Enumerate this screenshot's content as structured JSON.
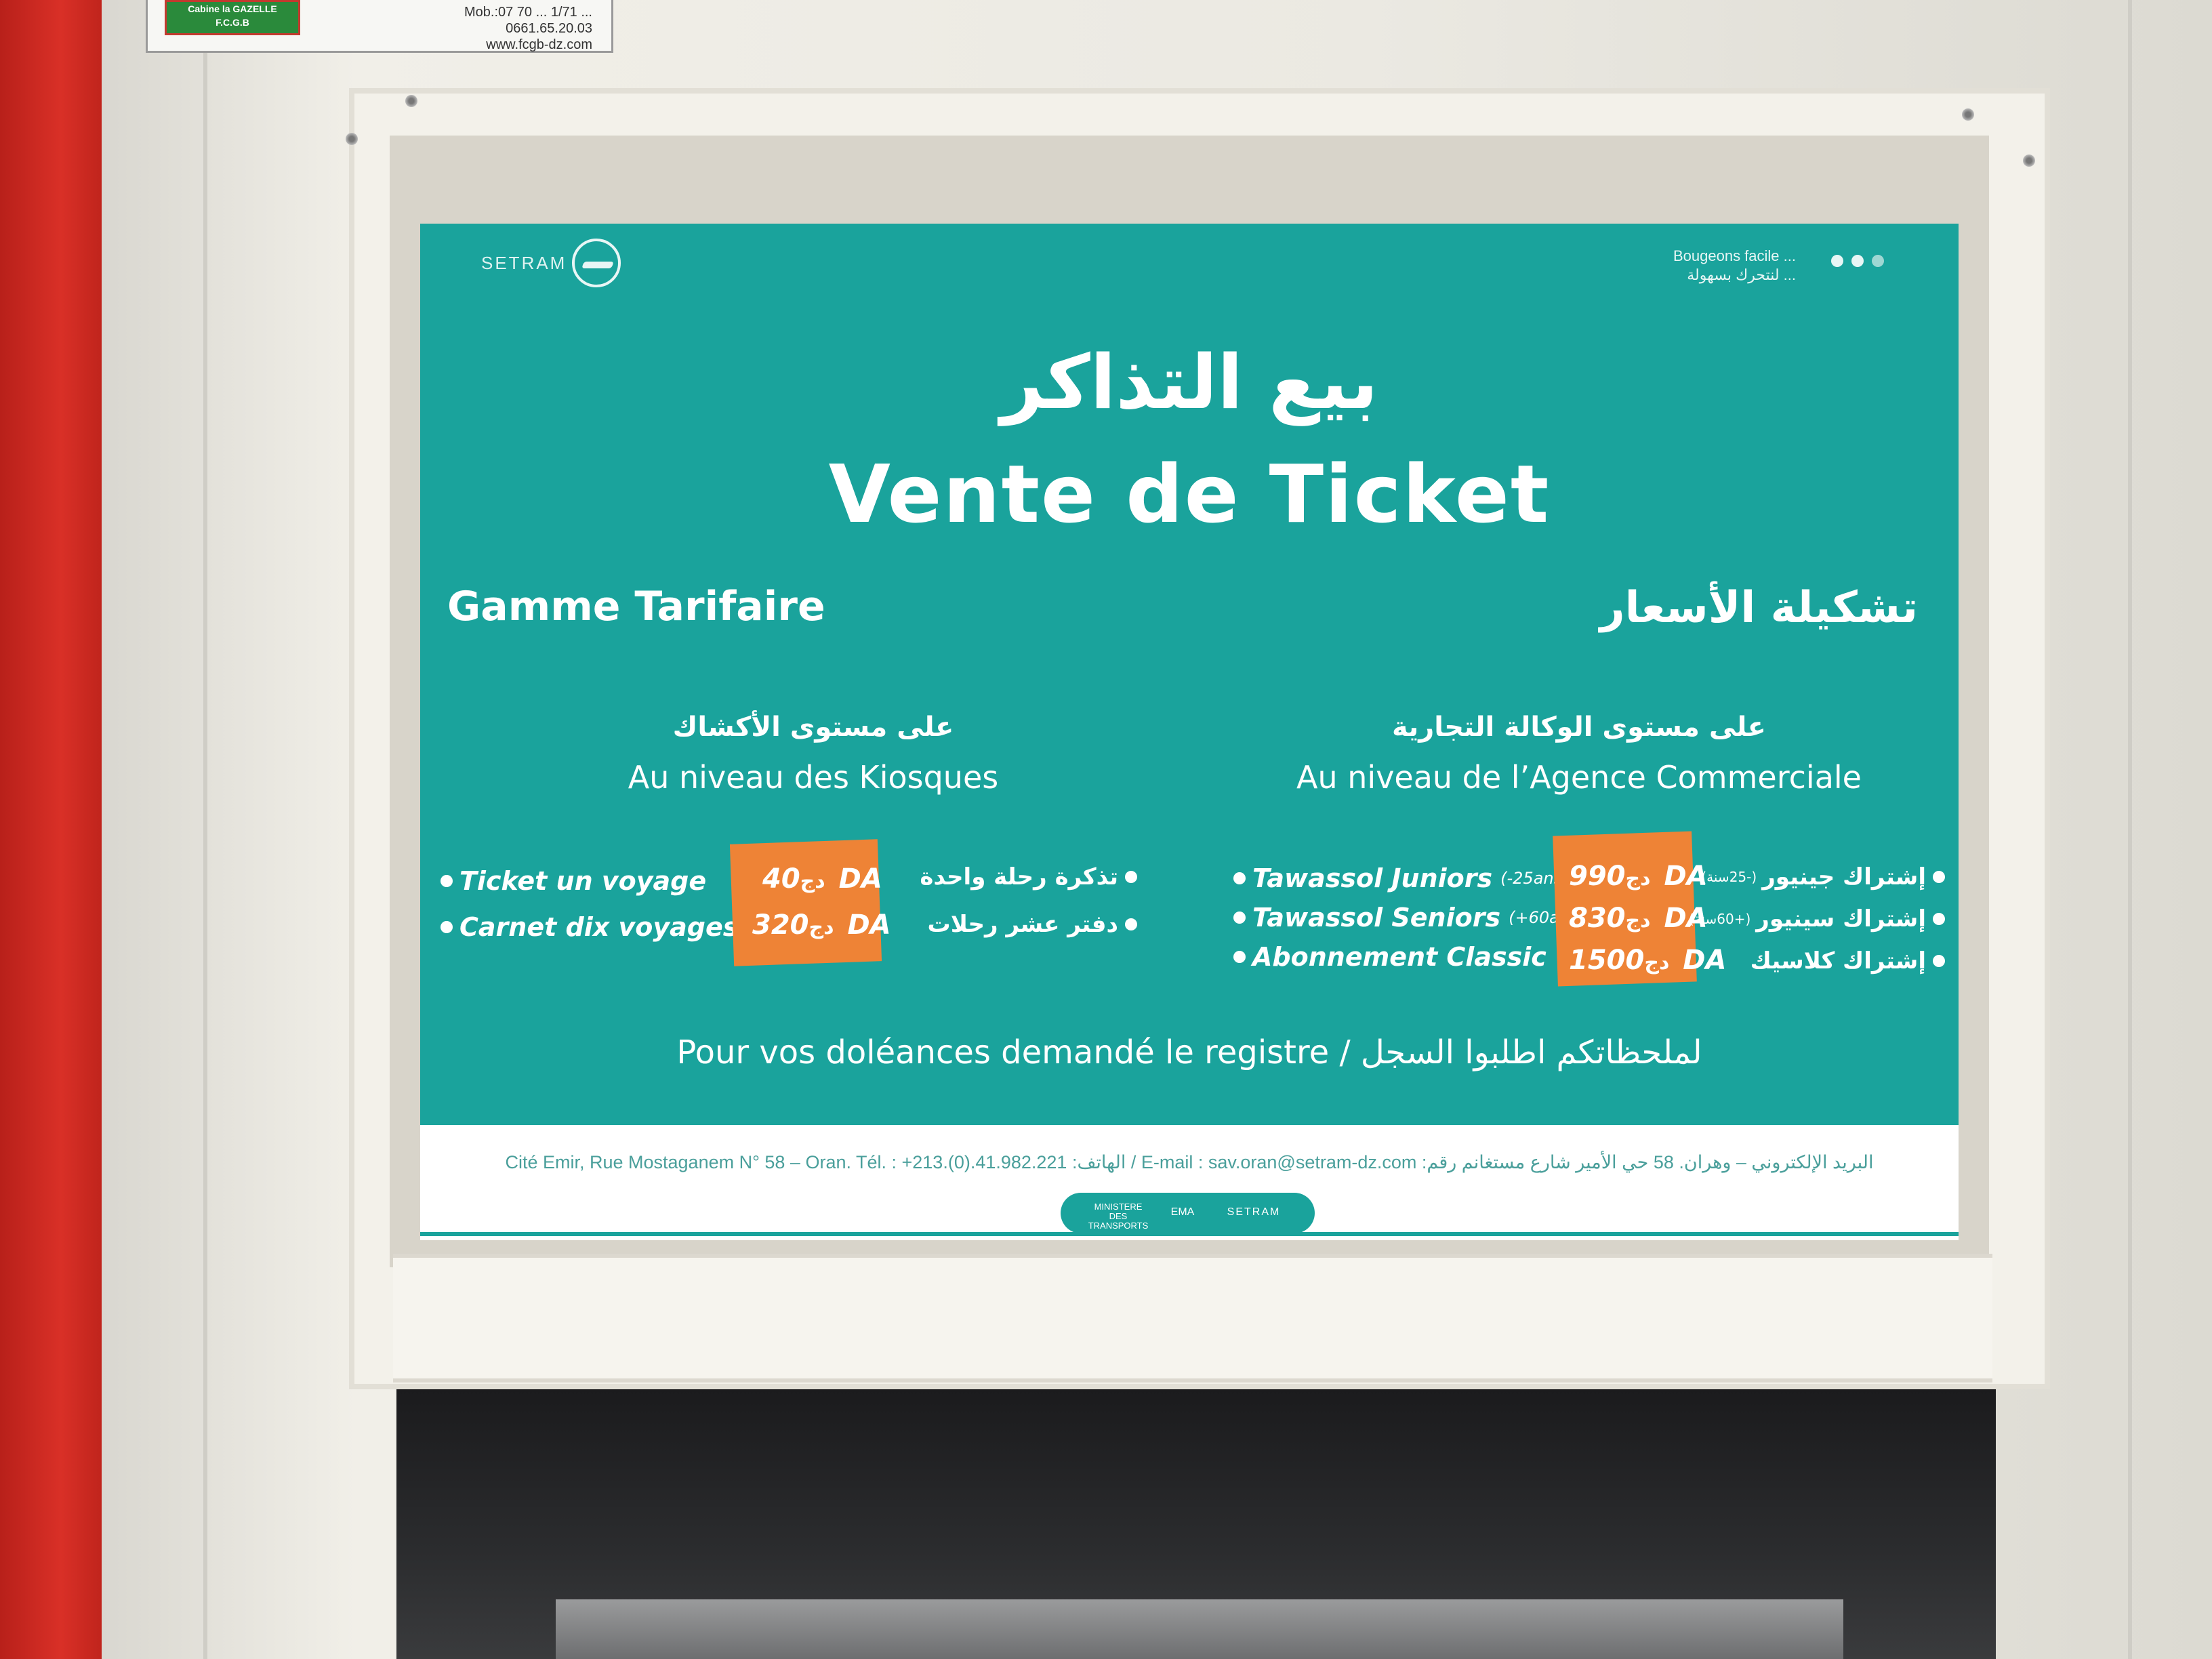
{
  "sticker": {
    "logo_line1": "Cabine la GAZELLE",
    "logo_line2": "F.C.G.B",
    "phone_line1": "Mob.:07 70 ... 1/71 ...",
    "phone_line2": "0661.65.20.03",
    "website": "www.fcgb-dz.com"
  },
  "sign": {
    "logo": "SETRAM",
    "slogan_fr": "Bougeons facile ...",
    "slogan_ar": "لنتحرك بسهولة ...",
    "title_ar": "بيع التذاكر",
    "title_fr": "Vente de Ticket",
    "gamme_fr": "Gamme Tarifaire",
    "gamme_ar": "تشكيلة الأسعار",
    "kiosques": {
      "heading_ar": "على مستوى الأكشاك",
      "heading_fr": "Au niveau des Kiosques",
      "items": [
        {
          "label_fr": "Ticket un voyage",
          "label_ar": "تذكرة رحلة واحدة",
          "price": "40 DA",
          "price_ar": "دج"
        },
        {
          "label_fr": "Carnet dix voyages",
          "label_ar": "دفتر عشر رحلات",
          "price": "320 DA",
          "price_ar": "دج"
        }
      ]
    },
    "agence": {
      "heading_ar": "على مستوى الوكالة التجارية",
      "heading_fr": "Au niveau de l’Agence Commerciale",
      "items": [
        {
          "label_fr": "Tawassol Juniors",
          "note_fr": "(-25ans)",
          "label_ar": "إشتراك جينيور",
          "note_ar": "(-25سنة)",
          "price": "990 DA",
          "price_ar": "دج"
        },
        {
          "label_fr": "Tawassol Seniors",
          "note_fr": "(+60ans)",
          "label_ar": "إشتراك سينيور",
          "note_ar": "(+60سنة)",
          "price": "830 DA",
          "price_ar": "دج"
        },
        {
          "label_fr": "Abonnement Classic",
          "note_fr": "",
          "label_ar": "إشتراك كلاسيك",
          "note_ar": "",
          "price": "1500 DA",
          "price_ar": "دج"
        }
      ]
    },
    "complaint": "Pour vos doléances demandé le registre / لملحظاتكم اطلبوا السجل",
    "footer_address": "Cité Emir, Rue Mostaganem N° 58 – Oran. Tél. : +213.(0).41.982.221 :الهاتف  / E-mail : sav.oran@setram-dz.com :البريد الإلكتروني  – وهران. 58 حي الأمير شارع مستغانم رقم",
    "footer_logos": {
      "ministry": "MINISTERE DES TRANSPORTS",
      "ema": "EMA",
      "setram": "SETRAM"
    }
  },
  "colors": {
    "teal": "#1aa39c",
    "orange": "#ee8336",
    "white": "#ffffff"
  }
}
